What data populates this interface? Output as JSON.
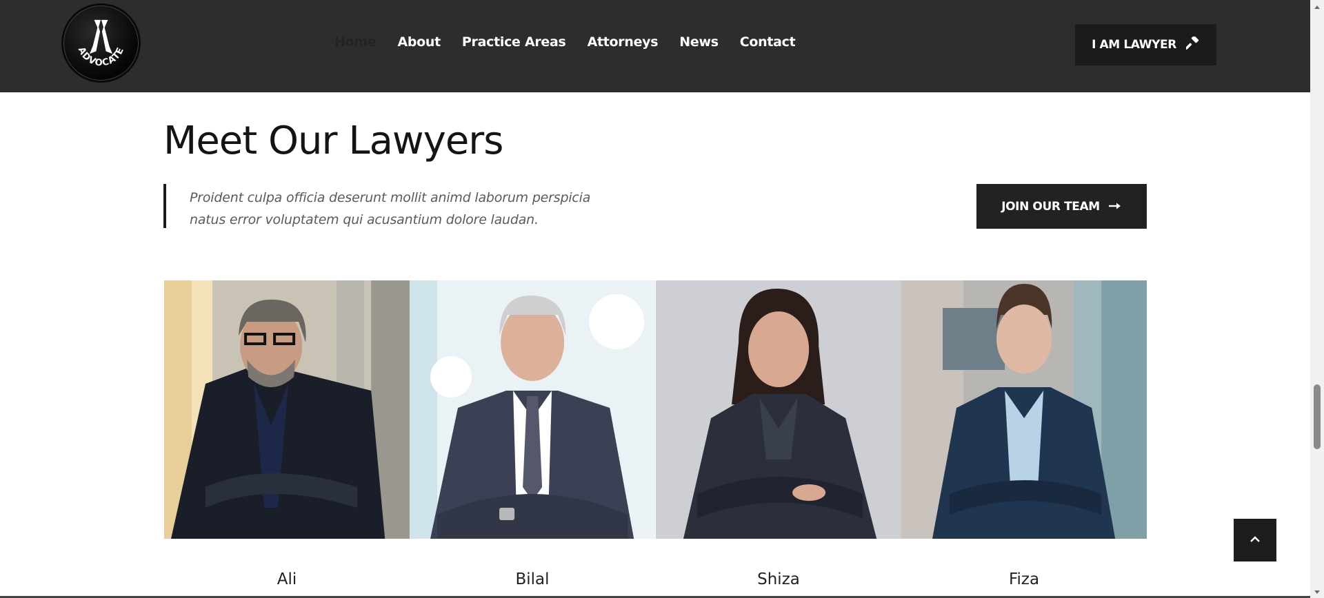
{
  "header": {
    "logo_text": "ADVOCATE",
    "nav": [
      {
        "label": "Home",
        "active": true
      },
      {
        "label": "About",
        "active": false
      },
      {
        "label": "Practice Areas",
        "active": false
      },
      {
        "label": "Attorneys",
        "active": false
      },
      {
        "label": "News",
        "active": false
      },
      {
        "label": "Contact",
        "active": false
      }
    ],
    "cta_label": "I AM LAWYER",
    "cta_icon": "gavel-icon"
  },
  "section": {
    "title": "Meet Our Lawyers",
    "quote": "Proident culpa officia deserunt mollit animd laborum perspicia natus error voluptatem qui acusantium dolore laudan.",
    "join_label": "JOIN OUR TEAM",
    "join_icon": "arrow-right-icon"
  },
  "lawyers": [
    {
      "name": "Ali"
    },
    {
      "name": "Bilal"
    },
    {
      "name": "Shiza"
    },
    {
      "name": "Fiza"
    }
  ],
  "back_to_top_icon": "chevron-up-icon",
  "colors": {
    "header_bg": "#2e2d2d",
    "button_bg": "#1c1b1b",
    "text": "#141414",
    "quote_text": "#5a5a5a"
  }
}
